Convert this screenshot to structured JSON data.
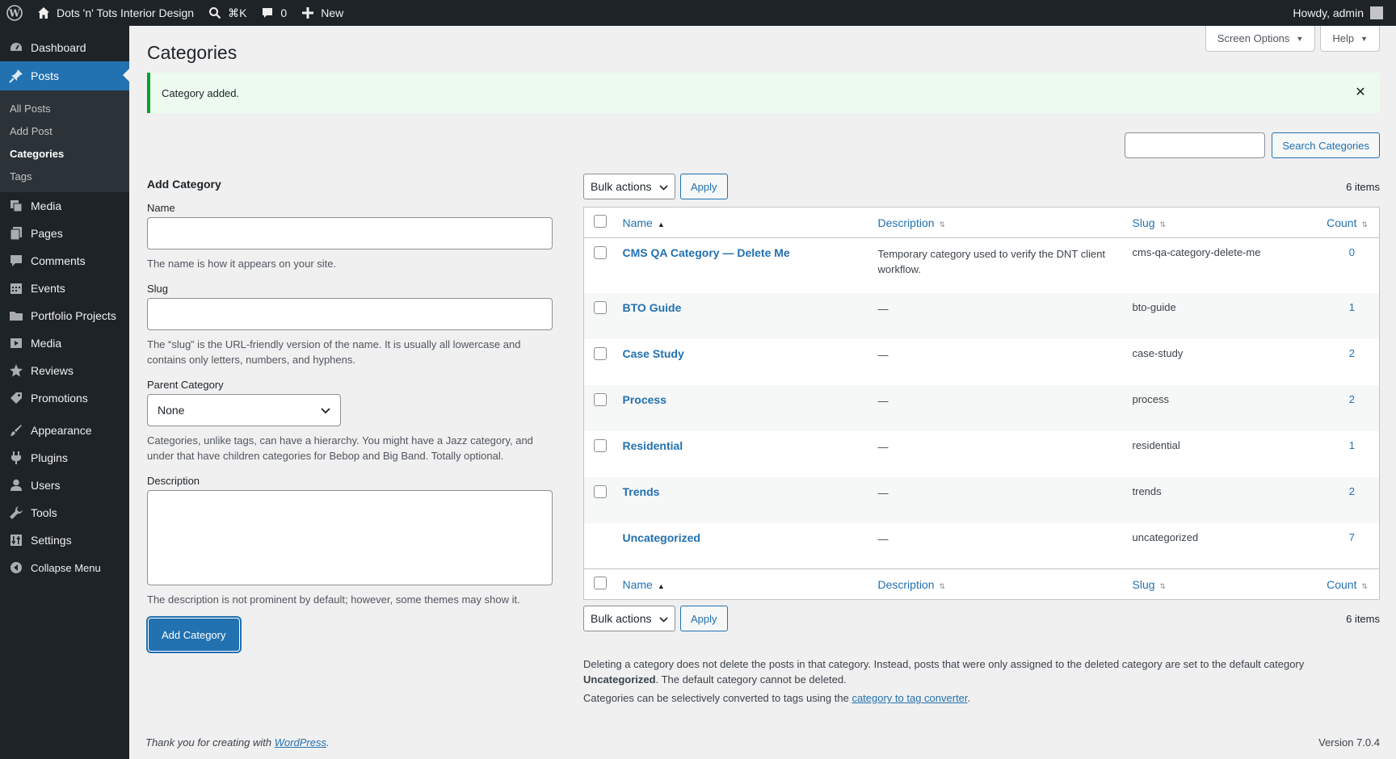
{
  "adminbar": {
    "site_name": "Dots 'n' Tots Interior Design",
    "shortcut": "⌘K",
    "comments_count": "0",
    "new_label": "New",
    "howdy": "Howdy, admin"
  },
  "sidebar": {
    "items": [
      {
        "label": "Dashboard",
        "icon": "dashboard-icon"
      },
      {
        "label": "Posts",
        "icon": "pushpin-icon"
      },
      {
        "label": "Media",
        "icon": "media-icon"
      },
      {
        "label": "Pages",
        "icon": "pages-icon"
      },
      {
        "label": "Comments",
        "icon": "comments-icon"
      },
      {
        "label": "Events",
        "icon": "calendar-icon"
      },
      {
        "label": "Portfolio Projects",
        "icon": "folder-icon"
      },
      {
        "label": "Media",
        "icon": "video-icon"
      },
      {
        "label": "Reviews",
        "icon": "star-icon"
      },
      {
        "label": "Promotions",
        "icon": "tag-icon"
      },
      {
        "label": "Appearance",
        "icon": "brush-icon"
      },
      {
        "label": "Plugins",
        "icon": "plugin-icon"
      },
      {
        "label": "Users",
        "icon": "user-icon"
      },
      {
        "label": "Tools",
        "icon": "wrench-icon"
      },
      {
        "label": "Settings",
        "icon": "settings-icon"
      },
      {
        "label": "Collapse Menu",
        "icon": "collapse-icon"
      }
    ],
    "submenu": [
      "All Posts",
      "Add Post",
      "Categories",
      "Tags"
    ]
  },
  "header": {
    "screen_options": "Screen Options",
    "help": "Help",
    "title": "Categories"
  },
  "notice": {
    "text": "Category added."
  },
  "search": {
    "button": "Search Categories"
  },
  "form": {
    "heading": "Add Category",
    "name_label": "Name",
    "name_help": "The name is how it appears on your site.",
    "slug_label": "Slug",
    "slug_help": "The “slug” is the URL-friendly version of the name. It is usually all lowercase and contains only letters, numbers, and hyphens.",
    "parent_label": "Parent Category",
    "parent_value": "None",
    "parent_help": "Categories, unlike tags, can have a hierarchy. You might have a Jazz category, and under that have children categories for Bebop and Big Band. Totally optional.",
    "desc_label": "Description",
    "desc_help": "The description is not prominent by default; however, some themes may show it.",
    "submit": "Add Category"
  },
  "table": {
    "bulk_actions": "Bulk actions",
    "apply": "Apply",
    "items_count": "6 items",
    "columns": {
      "name": "Name",
      "description": "Description",
      "slug": "Slug",
      "count": "Count"
    },
    "rows": [
      {
        "name": "CMS QA Category — Delete Me",
        "description": "Temporary category used to verify the DNT client workflow.",
        "slug": "cms-qa-category-delete-me",
        "count": "0",
        "checkbox": true
      },
      {
        "name": "BTO Guide",
        "description": "—",
        "slug": "bto-guide",
        "count": "1",
        "checkbox": true
      },
      {
        "name": "Case Study",
        "description": "—",
        "slug": "case-study",
        "count": "2",
        "checkbox": true
      },
      {
        "name": "Process",
        "description": "—",
        "slug": "process",
        "count": "2",
        "checkbox": true
      },
      {
        "name": "Residential",
        "description": "—",
        "slug": "residential",
        "count": "1",
        "checkbox": true
      },
      {
        "name": "Trends",
        "description": "—",
        "slug": "trends",
        "count": "2",
        "checkbox": true
      },
      {
        "name": "Uncategorized",
        "description": "—",
        "slug": "uncategorized",
        "count": "7",
        "checkbox": false
      }
    ]
  },
  "footnotes": {
    "line1_a": "Deleting a category does not delete the posts in that category. Instead, posts that were only assigned to the deleted category are set to the default category",
    "line1_bold": "Uncategorized",
    "line1_b": ". The default category cannot be deleted.",
    "line2_a": "Categories can be selectively converted to tags using the",
    "line2_link": "category to tag converter",
    "line2_b": "."
  },
  "footer": {
    "thanks": "Thank you for creating with",
    "wp_link": "WordPress",
    "period": ".",
    "version": "Version 7.0.4"
  },
  "colors": {
    "accent": "#2271b1",
    "adminbar": "#1d2327",
    "success": "#00a32a"
  }
}
